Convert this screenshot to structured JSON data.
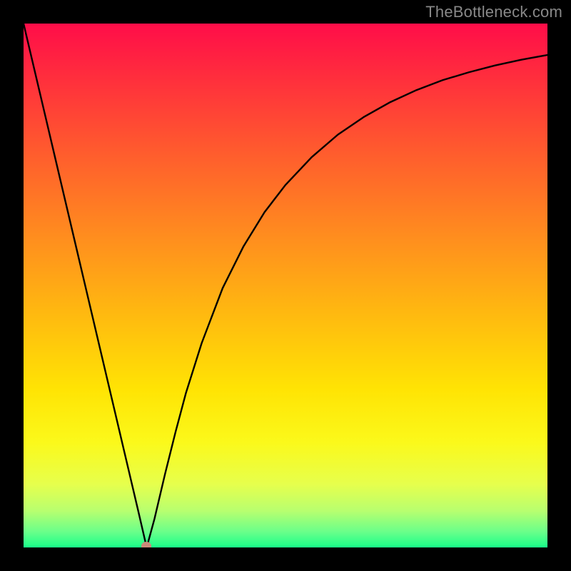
{
  "watermark": "TheBottleneck.com",
  "chart_data": {
    "type": "line",
    "title": "",
    "xlabel": "",
    "ylabel": "",
    "xlim": [
      0,
      100
    ],
    "ylim": [
      0,
      100
    ],
    "x": [
      0,
      2,
      4,
      6,
      8,
      10,
      12,
      14,
      16,
      18,
      20,
      22,
      23.5,
      25,
      27,
      29,
      31,
      34,
      38,
      42,
      46,
      50,
      55,
      60,
      65,
      70,
      75,
      80,
      85,
      90,
      95,
      100
    ],
    "y": [
      100,
      91.5,
      83.0,
      74.5,
      66.0,
      57.5,
      49.0,
      40.5,
      32.0,
      23.5,
      15.0,
      6.5,
      0.0,
      5.5,
      14.0,
      22.0,
      29.5,
      39.0,
      49.5,
      57.5,
      64.0,
      69.2,
      74.5,
      78.8,
      82.2,
      85.0,
      87.3,
      89.2,
      90.7,
      92.0,
      93.1,
      94.0
    ],
    "marker": {
      "x": 23.5,
      "y": 0.0
    },
    "gradient_stops": [
      {
        "pos": 0.0,
        "color": "#ff0d49"
      },
      {
        "pos": 0.1,
        "color": "#ff2d3d"
      },
      {
        "pos": 0.25,
        "color": "#ff5d2d"
      },
      {
        "pos": 0.4,
        "color": "#ff8b1f"
      },
      {
        "pos": 0.55,
        "color": "#ffb810"
      },
      {
        "pos": 0.7,
        "color": "#ffe404"
      },
      {
        "pos": 0.8,
        "color": "#fbf91b"
      },
      {
        "pos": 0.88,
        "color": "#e6ff4d"
      },
      {
        "pos": 0.93,
        "color": "#b8ff6f"
      },
      {
        "pos": 0.97,
        "color": "#6aff8a"
      },
      {
        "pos": 1.0,
        "color": "#19ff89"
      }
    ]
  }
}
